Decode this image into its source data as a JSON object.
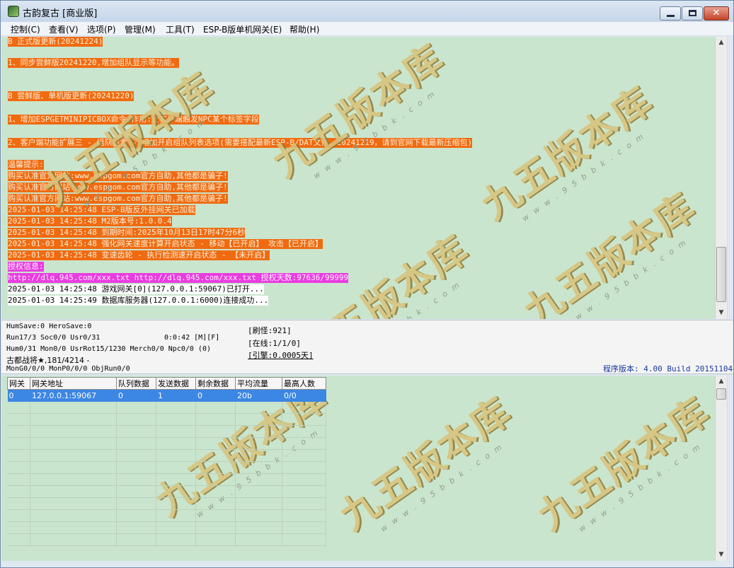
{
  "window": {
    "title": "古韵复古 [商业版]",
    "accent": "#f06a10",
    "grid_bg": "#cae5cd"
  },
  "menu": [
    "控制(C)",
    "查看(V)",
    "选项(P)",
    "管理(M)",
    "工具(T)",
    "ESP-B版单机网关(E)",
    "帮助(H)"
  ],
  "log": [
    {
      "text": "B 正式版更新(20241224)",
      "style": "orange"
    },
    {
      "text": "1、同步尝鲜版20241220,增加组队显示等功能。",
      "style": "orange"
    },
    {
      "text": "B 尝鲜版、单机版更新(20241220)",
      "style": "orange"
    },
    {
      "text": "1、增加ESPGETMINIPICBOX命令,作用:让客户端触发NPC某个标签字段",
      "style": "orange"
    },
    {
      "text": "2、客户端功能扩展三 - 组队设置 - 增加开启组队列表选项(需要搭配最新ESP-B/DAT文件，20241219，请到官网下载最新压缩包)",
      "style": "orange"
    },
    {
      "text": "温馨提示:",
      "style": "orange"
    },
    {
      "text": "购买认准官方网站:www.espgom.com官方自助,其他都是骗子!",
      "style": "orange"
    },
    {
      "text": "购买认准官方网站:www.espgom.com官方自助,其他都是骗子!",
      "style": "orange"
    },
    {
      "text": "购买认准官方网站:www.espgom.com官方自助,其他都是骗子!",
      "style": "orange"
    },
    {
      "text": "2025-01-03 14:25:48 ESP-B版反外挂网关已加载",
      "style": "orange"
    },
    {
      "text": "2025-01-03 14:25:48 M2版本号:1.0.0.4",
      "style": "orange"
    },
    {
      "text": "2025-01-03 14:25:48 到期时间:2025年10月13日17时47分6秒",
      "style": "orange"
    },
    {
      "text": "2025-01-03 14:25:48 强化网关速度计算开启状态 - 移动【已开启】 攻击【已开启】",
      "style": "orange"
    },
    {
      "text": "2025-01-03 14:25:48 变速齿轮 - 执行检测速开启状态 - 【未开启】",
      "style": "orange"
    },
    {
      "text": "授权信息:",
      "style": "magenta"
    },
    {
      "text": "http://dlq.945.com/xxx.txt http://dlq.945.com/xxx.txt 授权天数:97636/99999",
      "style": "magenta"
    },
    {
      "text": "2025-01-03 14:25:48 游戏网关[0](127.0.0.1:59067)已打开...",
      "style": "white"
    },
    {
      "text": "2025-01-03 14:25:49 数据库服务器(127.0.0.1:6000)连接成功...",
      "style": "white"
    }
  ],
  "status": {
    "line1": "HumSave:0 HeroSave:0",
    "line2": "Run17/3 Soc0/0 Usr0/31",
    "line3": "Hum0/31 Mon0/0 UsrRot15/1230 Merch0/0 Npc0/0 (0)",
    "line4": "古都战将★,181/4214 -",
    "line5": "MonG0/0/0 MonP0/0/0 ObjRun0/0",
    "timer": "0:0:42 [M][F]",
    "refresh": "[刷怪:921]",
    "online": "[在线:1/1/0]",
    "engine": "[引擎:0.0005天]",
    "version": "程序版本: 4.00 Build 20151104"
  },
  "gateway_table": {
    "columns": [
      "网关",
      "网关地址",
      "队列数据",
      "发送数据",
      "剩余数据",
      "平均流量",
      "最高人数"
    ],
    "rows": [
      [
        "0",
        "127.0.0.1:59067",
        "0",
        "1",
        "0",
        "20b",
        "0/0"
      ]
    ]
  },
  "watermark": {
    "title": "九五版本库",
    "url": "w w w . 9 5 b b k . c o m"
  }
}
